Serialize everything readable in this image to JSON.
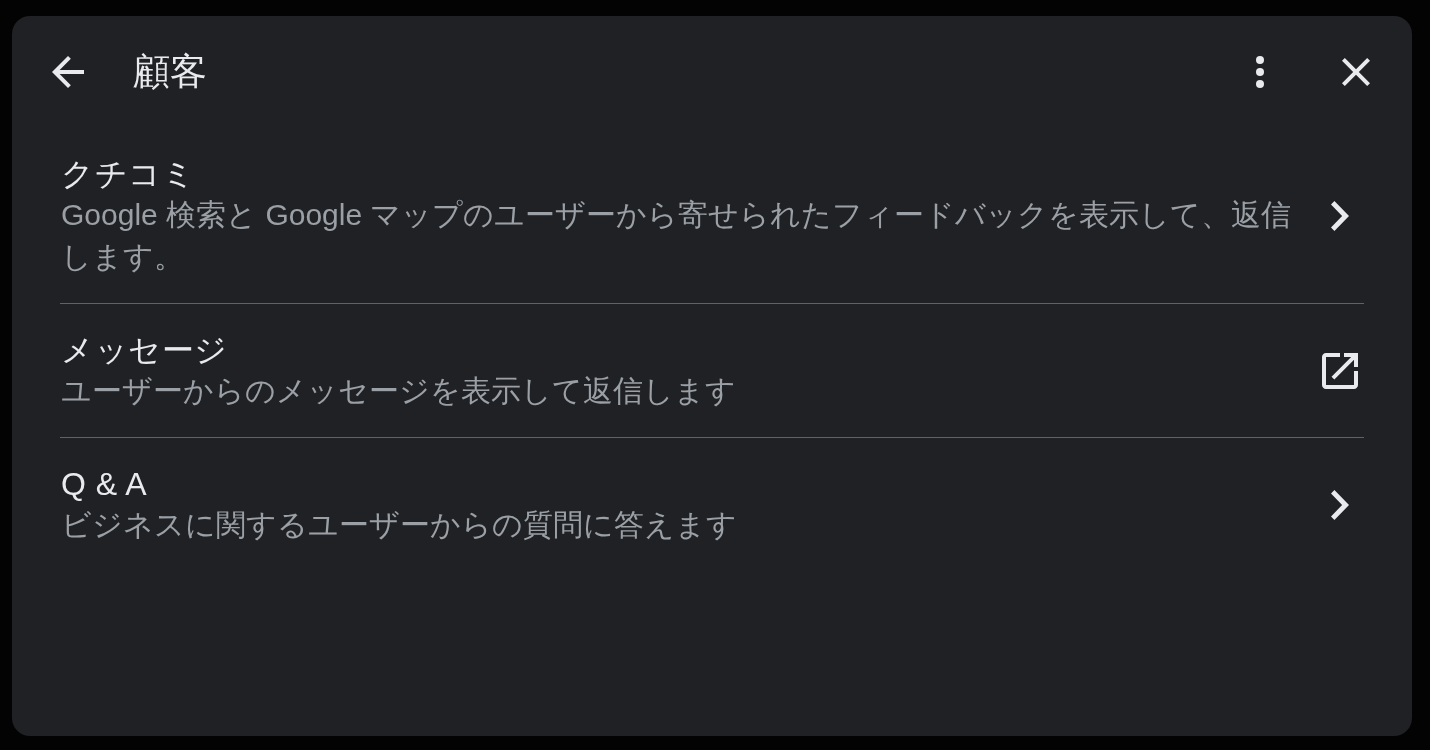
{
  "dialog": {
    "title": "顧客"
  },
  "items": [
    {
      "title": "クチコミ",
      "description": "Google 検索と Google マップのユーザーから寄せられたフィードバックを表示して、返信します。",
      "kind": "navigate"
    },
    {
      "title": "メッセージ",
      "description": "ユーザーからのメッセージを表示して返信します",
      "kind": "external"
    },
    {
      "title": "Q & A",
      "description": "ビジネスに関するユーザーからの質問に答えます",
      "kind": "navigate"
    }
  ]
}
